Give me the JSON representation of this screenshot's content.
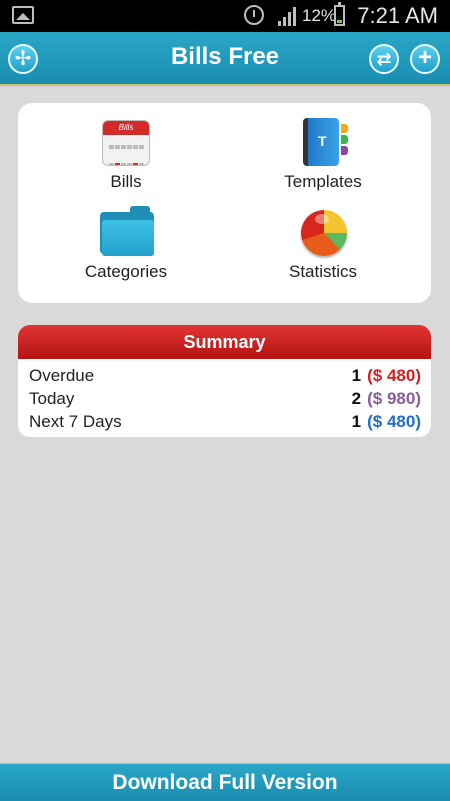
{
  "status_bar": {
    "battery": "12%",
    "time": "7:21 AM",
    "icons": [
      "gallery-icon",
      "alarm-icon",
      "signal-icon",
      "battery-icon"
    ]
  },
  "header": {
    "title": "Bills Free",
    "left_icon": "fan-menu-icon",
    "right_icons": [
      "sync-icon",
      "add-icon"
    ],
    "add_symbol": "+",
    "sync_symbol": "⇄",
    "menu_symbol": "✢"
  },
  "menu": {
    "items": [
      {
        "label": "Bills",
        "icon": "calendar-icon",
        "icon_text": "Bills"
      },
      {
        "label": "Templates",
        "icon": "address-book-icon"
      },
      {
        "label": "Categories",
        "icon": "folder-icon"
      },
      {
        "label": "Statistics",
        "icon": "pie-chart-icon"
      }
    ]
  },
  "summary": {
    "title": "Summary",
    "rows": [
      {
        "label": "Overdue",
        "count": "1",
        "amount": "($ 480)",
        "color": "#d32020"
      },
      {
        "label": "Today",
        "count": "2",
        "amount": "($ 980)",
        "color": "#8a5aa0"
      },
      {
        "label": "Next 7 Days",
        "count": "1",
        "amount": "($ 480)",
        "color": "#1d6fc9"
      }
    ]
  },
  "footer": {
    "download_label": "Download Full Version"
  },
  "colors": {
    "header": "#1a8db0",
    "summary_header": "#c81e1e",
    "background": "#d9d9d9"
  }
}
